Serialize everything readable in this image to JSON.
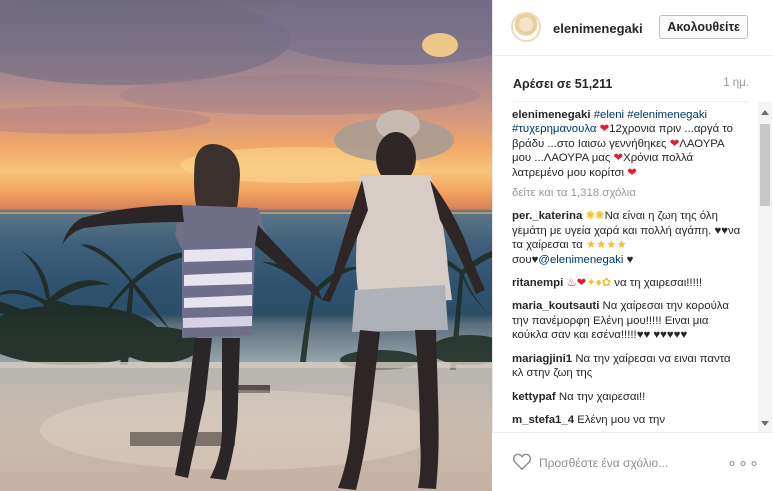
{
  "header": {
    "username": "elenimenegaki",
    "follow_label": "Ακολουθείτε"
  },
  "stats": {
    "likes": "Αρέσει σε 51,211",
    "time": "1 ημ."
  },
  "caption": {
    "username": "elenimenegaki",
    "tags": "#eleni #elenimenegaki #τυχερημανουλα",
    "text1": "12χρονια πριν ...αργά το βράδυ ...στο Ιαισω γεννήθηκες",
    "text2": "ΛΑΟΥΡΑ μου ...ΛΑΟΥΡΑ μας",
    "text3": "Χρόνια πολλά λατρεμένο μου κορίτσι"
  },
  "view_all": "δείτε και τα 1,318 σχόλια",
  "comments": [
    {
      "user": "per._katerina",
      "text_a": "Να είναι η ζωη της όλη γεμάτη με υγεία χαρά και πολλή αγάπη.",
      "text_b": "να τα χαίρεσαι τα",
      "text_c": "σου",
      "mention": "@elenimenegaki"
    },
    {
      "user": "ritanempi",
      "text": "να τη χαιρεσαι!!!!!"
    },
    {
      "user": "maria_koutsauti",
      "text": "Να χαίρεσαι την κορούλα την πανέμορφη Ελένη μου!!!!! Ειναι μια κούκλα σαν και εσένα!!!!!"
    },
    {
      "user": "mariagjini1",
      "text": "Να την χαίρεσαι να ειναι παντα κλ στην ζωη της"
    },
    {
      "user": "kettypaf",
      "text": "Να την χαιρεσαι!!"
    },
    {
      "user": "m_stefa1_4",
      "text": "Ελένη μου να την"
    }
  ],
  "add_comment": {
    "placeholder": "Προσθέστε ένα σχόλιο...",
    "more": "∘∘∘"
  },
  "icons": {
    "like": "heart-outline-icon",
    "more": "more-options-icon"
  },
  "colors": {
    "hashtag": "#003569",
    "heart": "#e0202e",
    "muted": "#999999"
  }
}
